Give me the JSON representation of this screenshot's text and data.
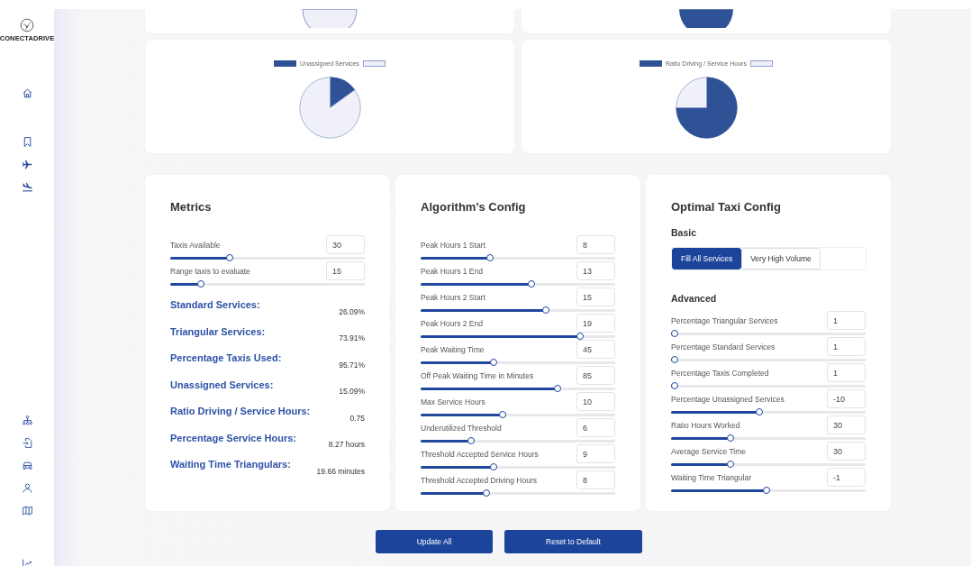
{
  "sidebar": {
    "brand": "CONECTADRIVE",
    "top_icons": [
      {
        "kind": "home"
      },
      {
        "kind": "bookmark"
      },
      {
        "kind": "takeoff"
      },
      {
        "kind": "landing"
      }
    ],
    "bottom_icons": [
      {
        "kind": "hierarchy"
      },
      {
        "kind": "file-import"
      },
      {
        "kind": "car"
      },
      {
        "kind": "user"
      },
      {
        "kind": "map"
      },
      {
        "kind": "chart"
      }
    ]
  },
  "partial_charts": [
    {
      "kind": "light"
    },
    {
      "kind": "dark"
    }
  ],
  "charts": [
    {
      "chart_data": {
        "type": "pie",
        "categories": [
          "Unassigned Services",
          null
        ],
        "values": [
          15.09,
          84.91
        ]
      }
    },
    {
      "chart_data": {
        "type": "pie",
        "categories": [
          "Ratio Driving / Service Hours",
          null
        ],
        "values": [
          75,
          25
        ]
      }
    }
  ],
  "metrics": {
    "title": "Metrics",
    "sliders": [
      {
        "label": "Taxis Available",
        "value": "30",
        "level": 0.3
      },
      {
        "label": "Range taxis to evaluate",
        "value": "15",
        "level": 0.145
      }
    ],
    "results": [
      {
        "label": "Standard Services:",
        "value": "26.09%"
      },
      {
        "label": "Triangular Services:",
        "value": "73.91%"
      },
      {
        "label": "Percentage Taxis Used:",
        "value": "95.71%"
      },
      {
        "label": "Unassigned Services:",
        "value": "15.09%"
      },
      {
        "label": "Ratio Driving / Service Hours:",
        "value": "0.75"
      },
      {
        "label": "Percentage Service Hours:",
        "value": "8.27 hours"
      },
      {
        "label": "Waiting Time Triangulars:",
        "value": "19.66 minutes"
      }
    ]
  },
  "algorithm": {
    "title": "Algorithm's Config",
    "sliders": [
      {
        "label": "Peak Hours 1 Start",
        "value": "8",
        "level": 0.35
      },
      {
        "label": "Peak Hours 1 End",
        "value": "13",
        "level": 0.57
      },
      {
        "label": "Peak Hours 2 Start",
        "value": "15",
        "level": 0.65
      },
      {
        "label": "Peak Hours 2 End",
        "value": "19",
        "level": 0.83
      },
      {
        "label": "Peak Waiting Time",
        "value": "45",
        "level": 0.37
      },
      {
        "label": "Off Peak Waiting Time in Minutes",
        "value": "85",
        "level": 0.71
      },
      {
        "label": "Max Service Hours",
        "value": "10",
        "level": 0.42
      },
      {
        "label": "Underutilized Threshold",
        "value": "6",
        "level": 0.25
      },
      {
        "label": "Threshold Accepted Service Hours",
        "value": "9",
        "level": 0.37
      },
      {
        "label": "Threshold Accepted Driving Hours",
        "value": "8",
        "level": 0.33
      }
    ]
  },
  "optimal": {
    "title": "Optimal Taxi Config",
    "basic_heading": "Basic",
    "presets": [
      {
        "label": "Fill All Services",
        "selected": true
      },
      {
        "label": "Very High Volume",
        "selected": false
      }
    ],
    "advanced_heading": "Advanced",
    "sliders": [
      {
        "label": "Percentage Triangular Services",
        "value": "1",
        "level": 0
      },
      {
        "label": "Percentage Standard Services",
        "value": "1",
        "level": 0
      },
      {
        "label": "Percentage Taxis Completed",
        "value": "1",
        "level": 0
      },
      {
        "label": "Percentage Unassigned Services",
        "value": "-10",
        "level": 0.45
      },
      {
        "label": "Ratio Hours Worked",
        "value": "30",
        "level": 0.3
      },
      {
        "label": "Average Service Time",
        "value": "30",
        "level": 0.3
      },
      {
        "label": "Waiting Time Triangular",
        "value": "-1",
        "level": 0.49
      }
    ]
  },
  "buttons": [
    "Update All",
    "Reset to Default"
  ]
}
